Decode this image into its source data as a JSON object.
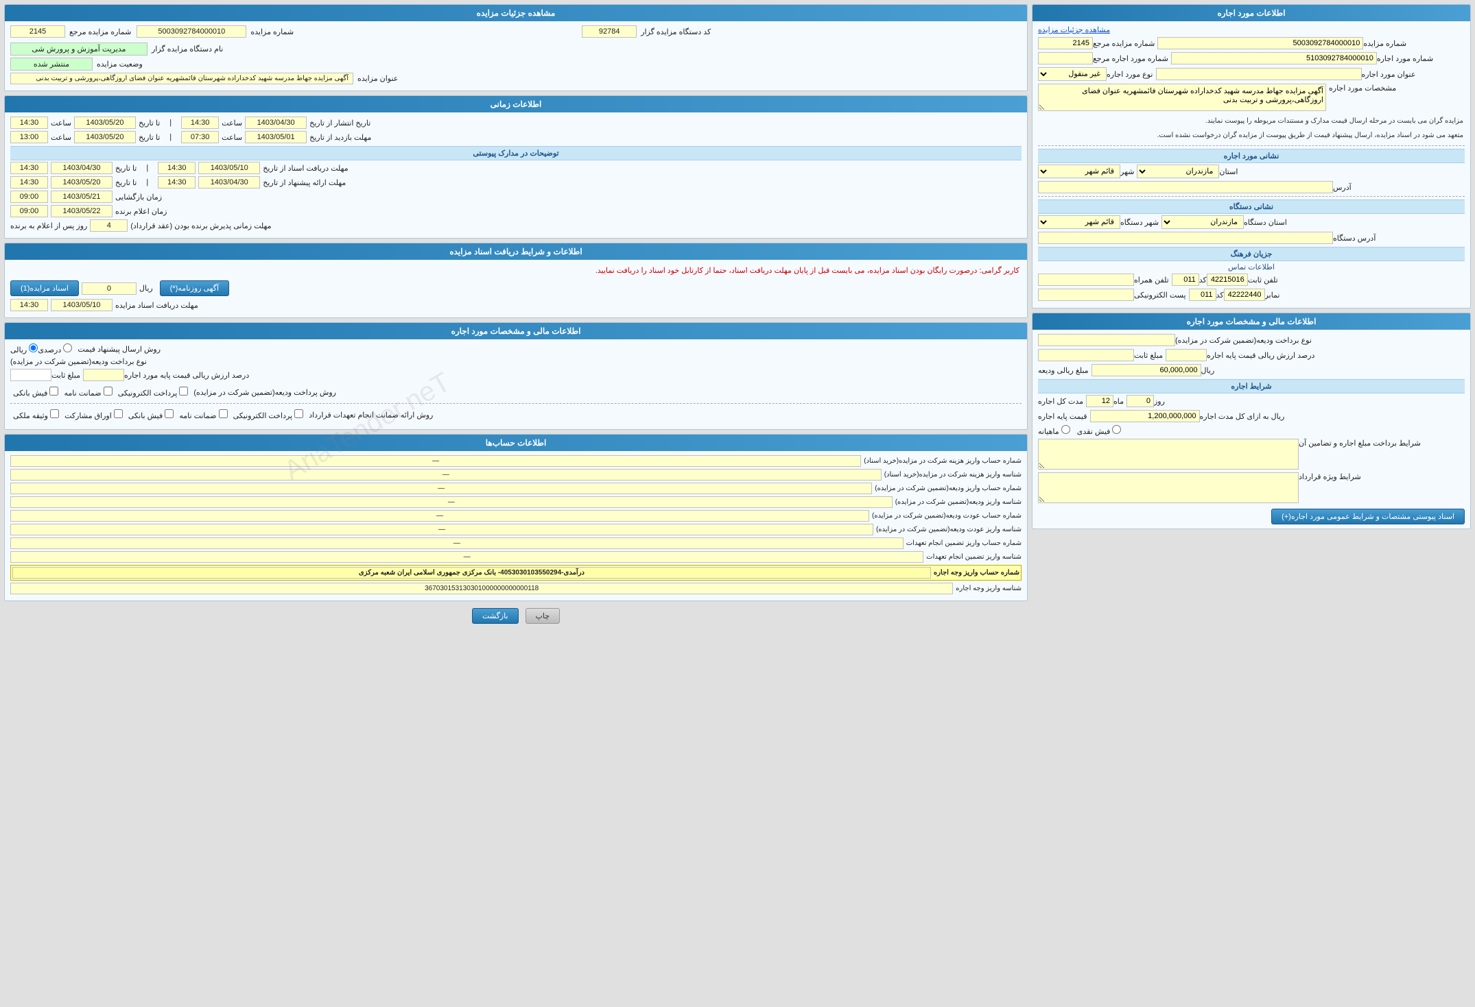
{
  "left": {
    "main_section_title": "اطلاعات مورد اجاره",
    "auction_link": "مشاهده جزئیات مزایده",
    "fields": {
      "auction_number_label": "شماره مزایده",
      "auction_number_value": "5003092784000010",
      "auction_ref_label": "شماره مزایده مرجع",
      "auction_ref_value": "2145",
      "rent_number_label": "شماره مورد اجاره",
      "rent_number_value": "5103092784000010",
      "rent_ref_label": "شماره مورد اجاره مرجع",
      "rent_ref_value": "",
      "rent_title_label": "عنوان مورد اجاره",
      "rent_type_label": "نوع مورد اجاره",
      "rent_type_value": "غیر منقول",
      "description_label": "مشخصات مورد اجاره",
      "description_value": "آگهی مزایده جهاط مدرسه شهید کدخداراده شهرستان فائمشهریه عنوان فضای اروزگاهی،پرورشی و تربیت بدنی"
    },
    "info_text1": "مزایده گران می بایست در مرحله ارسال قیمت مدارک و مستندات مربوطه را پیوست نمایند.",
    "info_text2": "متعهد می شود در اسناد مزایده، ارسال پیشنهاد قیمت از طریق پیوست از مزایده گران درخواست نشده است.",
    "location_section": "نشانی مورد اجاره",
    "province_label": "استان",
    "province_value": "مازندران",
    "city_label": "شهر",
    "city_value": "قائم شهر",
    "address_label": "آدرس",
    "address_value": "",
    "device_section": "نشانی دستگاه",
    "device_province_label": "استان دستگاه",
    "device_province_value": "مازندران",
    "device_city_label": "شهر دستگاه",
    "device_city_value": "قائم شهر",
    "device_address_label": "آدرس دستگاه",
    "device_address_value": "",
    "contact_section": "جزیان فرهنگ",
    "contact_info_label": "اطلاعات تماس",
    "phone_label": "تلفن ثابت",
    "phone_code": "011",
    "phone_value": "42215016",
    "mobile_label": "تلفن همراه",
    "fax_label": "نمابر",
    "fax_code": "011",
    "fax_value": "42222440",
    "email_label": "پست الکترونیکی",
    "financial_section": "اطلاعات مالی و مشخصات مورد اجاره",
    "deposit_type_label": "نوع برداخت ودیعه(تضمین شرکت در مزایده)",
    "deposit_type_value": "",
    "percent_label": "درصد ارزش ریالی قیمت پایه اجاره",
    "percent_value": "",
    "fixed_amount_label": "مبلغ ثابت",
    "fine_label": "مبلغ ریالی ودیعه",
    "fine_value": "60,000,000",
    "fine_currency": "ریال",
    "conditions_section": "شرایط اجاره",
    "duration_label": "مدت کل اجاره",
    "duration_months": "12",
    "duration_days_label": "ماه",
    "duration_days": "0",
    "duration_day_label": "روز",
    "base_price_label": "قیمت پایه اجاره",
    "base_price_value": "1,200,000,000",
    "base_price_suffix": "ریال به ازای کل مدت اجاره",
    "installments_section": "ماهیانه",
    "cash_section": "فیش نقدی",
    "payment_conditions_label": "شرایط برداخت مبلغ اجاره و تضامین آن",
    "special_conditions_label": "شرایط ویژه قرارداد",
    "attachment_btn": "اسناد پیوستی مشتصات و شرایط عمومی مورد اجاره(+)"
  },
  "right": {
    "auction_details_title": "مشاهده جزئیات مزایده",
    "auction_code_label": "کد دستگاه مزایده گزار",
    "auction_code_value": "92784",
    "auction_num_label": "شماره مزایده",
    "auction_num_value": "5003092784000010",
    "auction_ref_label": "شماره مزایده مرجع",
    "auction_ref_value": "2145",
    "subject_label": "نام دستگاه مزایده گزار",
    "subject_value": "مدیریت آموزش و پرورش شی",
    "status_label": "وضعیت مزایده",
    "status_value": "منتشر شده",
    "title_label": "عنوان مزایده",
    "title_value": "آگهی مزایده جهاط مدرسه شهید کدخداراده شهرستان قائمشهریه عنوان فضای اروزگاهی،پرورشی و تربیت بدنی",
    "time_section": "اطلاعات زمانی",
    "publish_date_label": "تاریخ انتشار از تاریخ",
    "publish_date_from": "1403/04/30",
    "publish_time_from_label": "ساعت",
    "publish_time_from": "14:30",
    "publish_date_to_label": "تا تاریخ",
    "publish_date_to": "1403/05/20",
    "publish_time_to_label": "ساعت",
    "publish_time_to": "14:30",
    "bid_deadline_label": "مهلت بازدید از تاریخ",
    "bid_deadline_from": "1403/05/01",
    "bid_deadline_time_from_label": "ساعت",
    "bid_deadline_time_from": "07:30",
    "bid_deadline_to_label": "تا تاریخ",
    "bid_deadline_to": "1403/05/20",
    "bid_deadline_time_to_label": "ساعت",
    "bid_deadline_time_to": "13:00",
    "descriptions_label": "توضیحات",
    "desc_section": "توضیحات در مدارک پیوستی",
    "submit_deadline_label": "مهلت دریافت اسناد از تاریخ",
    "submit_deadline_from": "1403/05/10",
    "submit_time_from": "14:30",
    "submit_to_label": "تا تاریخ",
    "submit_to": "1403/04/30",
    "submit_time_to": "14:30",
    "offer_deadline_label": "مهلت ارائه پیشنهاد از تاریخ",
    "offer_deadline_from": "1403/04/30",
    "offer_time_from": "14:30",
    "offer_to_label": "تا تاریخ",
    "offer_to": "1403/05/20",
    "offer_time_to": "14:30",
    "opening_date_label": "زمان بازگشایی",
    "opening_date": "1403/05/21",
    "opening_time": "09:00",
    "winner_date_label": "زمان اعلام برنده",
    "winner_date": "1403/05/22",
    "winner_time": "09:00",
    "winner_days_label": "مهلت زمانی پذیرش برنده بودن (عقد قرارداد)",
    "winner_days": "4",
    "winner_days_suffix": "روز پس از اعلام به برنده",
    "docs_section": "اطلاعات و شرایط دریافت اسناد مزایده",
    "docs_warning": "کاربر گرامی: درصورت رایگان بودن اسناد مزایده، می بایست قبل از پایان مهلت دریافت اسناد، حتما از کارتابل خود اسناد را دریافت نمایید.",
    "deposit_doc_label": "اسناد مزایده(1)",
    "deposit_amount_label": "ریال",
    "deposit_amount_value": "0",
    "free_label": "آگهی روزنامه(*)",
    "doc_deadline_label": "مهلت دریافت اسناد مزایده",
    "doc_deadline_date": "1403/05/10",
    "doc_deadline_time": "14:30",
    "rental_financial_title": "اطلاعات مالی و مشخصات مورد اجاره",
    "send_method_label": "روش ارسال پیشنهاد قیمت",
    "send_method_rial": "ریالی",
    "send_method_percent": "درصدی",
    "deposit_type2_label": "نوع برداخت ودیعه(تضمین شرکت در مزایده)",
    "fixed_label": "مبلغ ثابت",
    "percent2_label": "درصد ارزش ریالی قیمت پایه مورد اجاره",
    "percent2_input": "",
    "payment_methods_label": "روش پرداخت ودیعه(تضمین شرکت در مزایده)",
    "payment_electronic": "پرداخت الکترونیکی",
    "payment_check": "ضمانت نامه",
    "payment_cash": "فیش بانکی",
    "contract_methods_label": "روش ارائه ضمانت انجام تعهدات قرارداد",
    "contract_electronic": "پرداخت الکترونیکی",
    "contract_check": "ضمانت نامه",
    "contract_cash": "فیش بانکی",
    "contract_shares": "اوراق مشارکت",
    "contract_property": "وثیقه ملکی",
    "accounts_title": "اطلاعات حساب‌ها",
    "account1_label": "شماره حساب واریز هزینه شرکت در مزایده(خرید اسناد)",
    "account1_value": "",
    "account2_label": "شناسه واریز هزینه شرکت در مزایده(خرید اسناد)",
    "account2_value": "",
    "account3_label": "شماره حساب واریز ودیعه(تضمین شرکت در مزایده)",
    "account3_value": "",
    "account4_label": "شناسه واریز ودیعه(تضمین شرکت در مزایده)",
    "account4_value": "",
    "account5_label": "شماره حساب عودت ودیعه(تضمین شرکت در مزایده)",
    "account5_value": "",
    "account6_label": "شناسه واریز عودت ودیعه(تضمین شرکت در مزایده)",
    "account6_value": "",
    "account7_label": "شماره حساب واریز تضمین انجام تعهدات",
    "account7_value": "",
    "account8_label": "شناسه واریز تضمین انجام تعهدات",
    "account8_value": "",
    "account9_label": "شماره حساب واریز وجه اجاره",
    "account9_value": "درآمدی-4053030103550294- بانک مرکزی جمهوری اسلامی ایران شعبه مرکزی",
    "account10_label": "شناسه واریز وجه اجاره",
    "account10_value": "367030153130301000000000000118",
    "back_btn": "بازگشت",
    "close_btn": "چاپ"
  }
}
